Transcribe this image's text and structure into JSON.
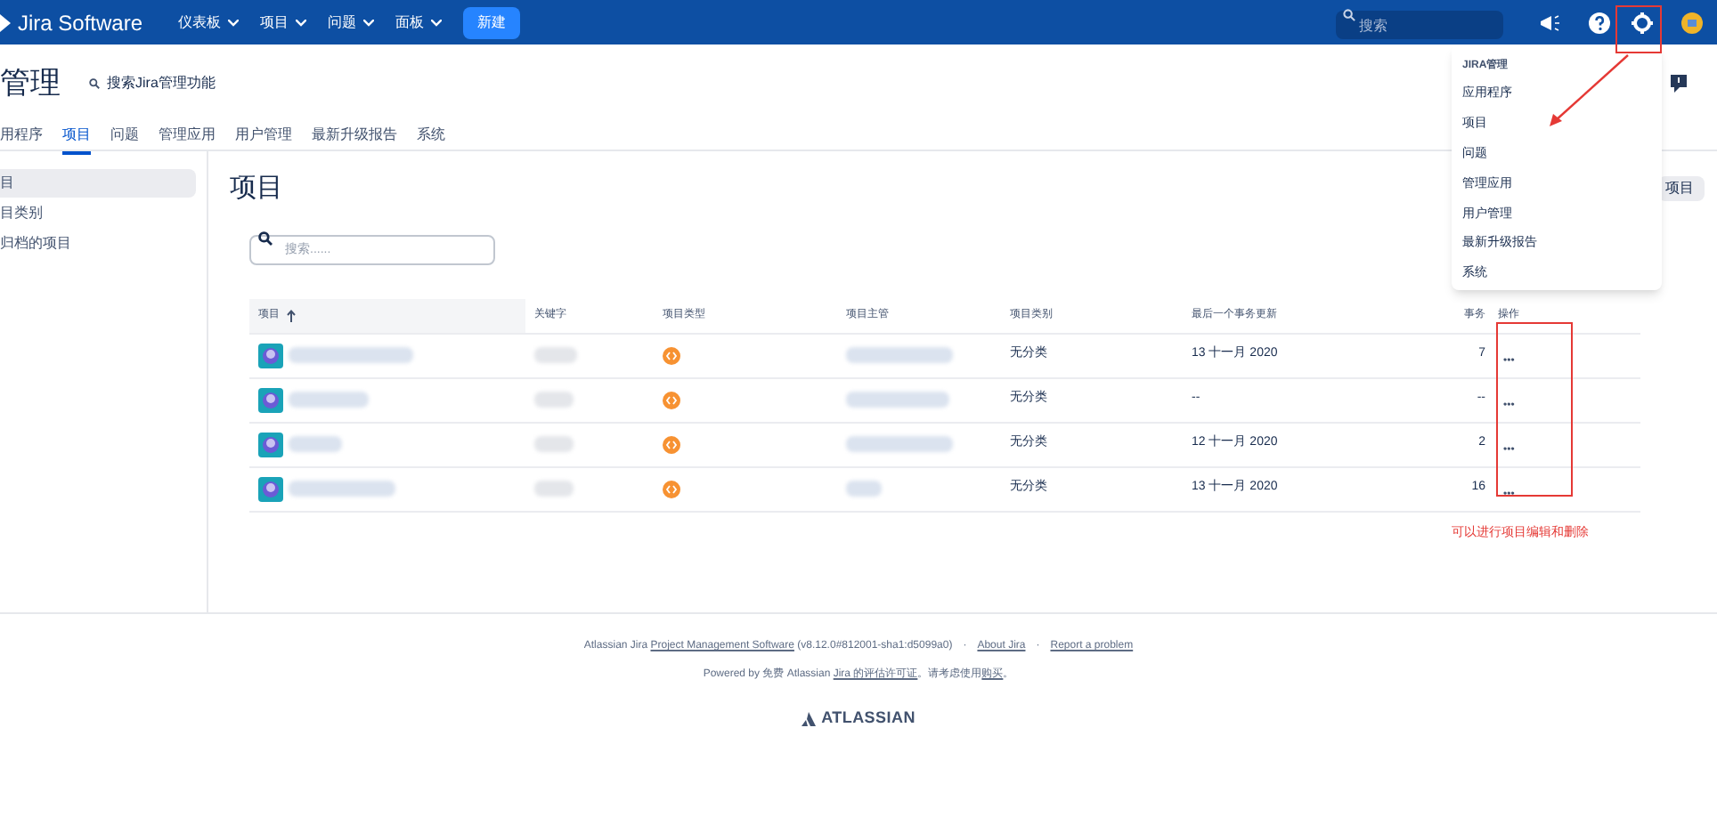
{
  "topbar": {
    "logo": "Jira Software",
    "menus": [
      {
        "label": "仪表板"
      },
      {
        "label": "项目"
      },
      {
        "label": "问题"
      },
      {
        "label": "面板"
      }
    ],
    "create": "新建",
    "search": {
      "placeholder": "搜索"
    }
  },
  "admin": {
    "title": "管理",
    "search_link": "搜索Jira管理功能"
  },
  "tabs": [
    {
      "label": "用程序",
      "selected": false
    },
    {
      "label": "项目",
      "selected": true
    },
    {
      "label": "问题",
      "selected": false
    },
    {
      "label": "管理应用",
      "selected": false
    },
    {
      "label": "用户管理",
      "selected": false
    },
    {
      "label": "最新升级报告",
      "selected": false
    },
    {
      "label": "系统",
      "selected": false
    }
  ],
  "sidebar": {
    "items": [
      {
        "label": "目",
        "selected": true
      },
      {
        "label": "目类别",
        "selected": false
      },
      {
        "label": "归档的项目",
        "selected": false
      }
    ]
  },
  "main": {
    "title": "项目",
    "search": {
      "placeholder": "搜索......"
    },
    "corner_button": "项目"
  },
  "table": {
    "columns": [
      {
        "label": "项目",
        "sorted": true
      },
      {
        "label": "关键字",
        "sorted": false
      },
      {
        "label": "项目类型",
        "sorted": false
      },
      {
        "label": "项目主管",
        "sorted": false
      },
      {
        "label": "项目类别",
        "sorted": false
      },
      {
        "label": "最后一个事务更新",
        "sorted": false
      },
      {
        "label": "事务",
        "sorted": false
      },
      {
        "label": "操作",
        "sorted": false
      }
    ],
    "rows": [
      {
        "category": "无分类",
        "updated": "13 十一月 2020",
        "issues": "7",
        "action": "•••"
      },
      {
        "category": "无分类",
        "updated": "--",
        "issues": "--",
        "action": "•••"
      },
      {
        "category": "无分类",
        "updated": "12 十一月 2020",
        "issues": "2",
        "action": "•••"
      },
      {
        "category": "无分类",
        "updated": "13 十一月 2020",
        "issues": "16",
        "action": "•••"
      }
    ]
  },
  "annotation": {
    "note": "可以进行项目编辑和删除"
  },
  "admin_menu": {
    "heading": "JIRA管理",
    "items": [
      {
        "label": "应用程序"
      },
      {
        "label": "项目"
      },
      {
        "label": "问题"
      },
      {
        "label": "管理应用"
      },
      {
        "label": "用户管理"
      },
      {
        "label": "最新升级报告"
      },
      {
        "label": "系统"
      }
    ]
  },
  "footer": {
    "lines": [
      [
        {
          "kind": "text",
          "text": "Atlassian Jira "
        },
        {
          "kind": "link",
          "text": "Project Management Software"
        },
        {
          "kind": "text",
          "text": " (v8.12.0#812001-sha1:d5099a0)"
        },
        {
          "kind": "sep",
          "text": "·"
        },
        {
          "kind": "link",
          "text": "About Jira"
        },
        {
          "kind": "sep",
          "text": "·"
        },
        {
          "kind": "link",
          "text": "Report a problem"
        }
      ],
      [
        {
          "kind": "text",
          "text": "Powered by 免费 Atlassian "
        },
        {
          "kind": "link",
          "text": "Jira 的评估许可证"
        },
        {
          "kind": "text",
          "text": "。请考虑使用"
        },
        {
          "kind": "link",
          "text": "购买"
        },
        {
          "kind": "text",
          "text": "。"
        }
      ]
    ],
    "brand": "ATLASSIAN"
  }
}
